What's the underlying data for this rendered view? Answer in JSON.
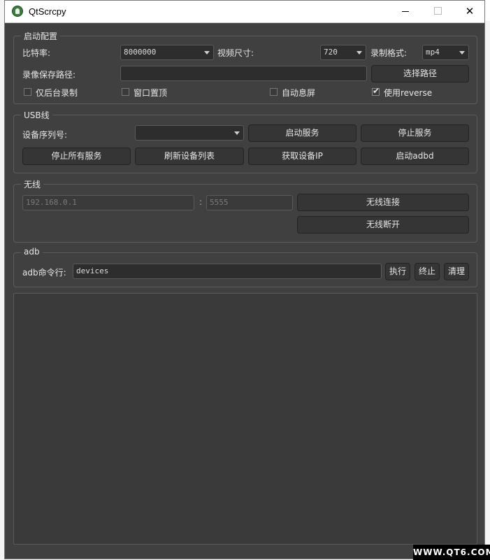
{
  "window": {
    "title": "QtScrcpy"
  },
  "startup": {
    "group_title": "启动配置",
    "bitrate_label": "比特率:",
    "bitrate_value": "8000000",
    "video_size_label": "视频尺寸:",
    "video_size_value": "720",
    "record_format_label": "录制格式:",
    "record_format_value": "mp4",
    "record_path_label": "录像保存路径:",
    "record_path_value": "",
    "select_path_button": "选择路径",
    "bg_record_label": "仅后台录制",
    "window_on_top_label": "窗口置顶",
    "auto_screen_off_label": "自动息屏",
    "use_reverse_label": "使用reverse",
    "use_reverse_checked": true
  },
  "usb": {
    "group_title": "USB线",
    "device_serial_label": "设备序列号:",
    "device_serial_value": "",
    "start_service_button": "启动服务",
    "stop_service_button": "停止服务",
    "stop_all_services_button": "停止所有服务",
    "refresh_devices_button": "刷新设备列表",
    "get_device_ip_button": "获取设备IP",
    "start_adbd_button": "启动adbd"
  },
  "wireless": {
    "group_title": "无线",
    "ip_placeholder": "192.168.0.1",
    "separator": ":",
    "port_placeholder": "5555",
    "connect_button": "无线连接",
    "disconnect_button": "无线断开"
  },
  "adb": {
    "group_title": "adb",
    "command_label": "adb命令行:",
    "command_value": "devices",
    "execute_button": "执行",
    "stop_button": "终止",
    "clear_button": "清理"
  },
  "log": {
    "content": ""
  },
  "watermark": "WWW.QT6.COM"
}
